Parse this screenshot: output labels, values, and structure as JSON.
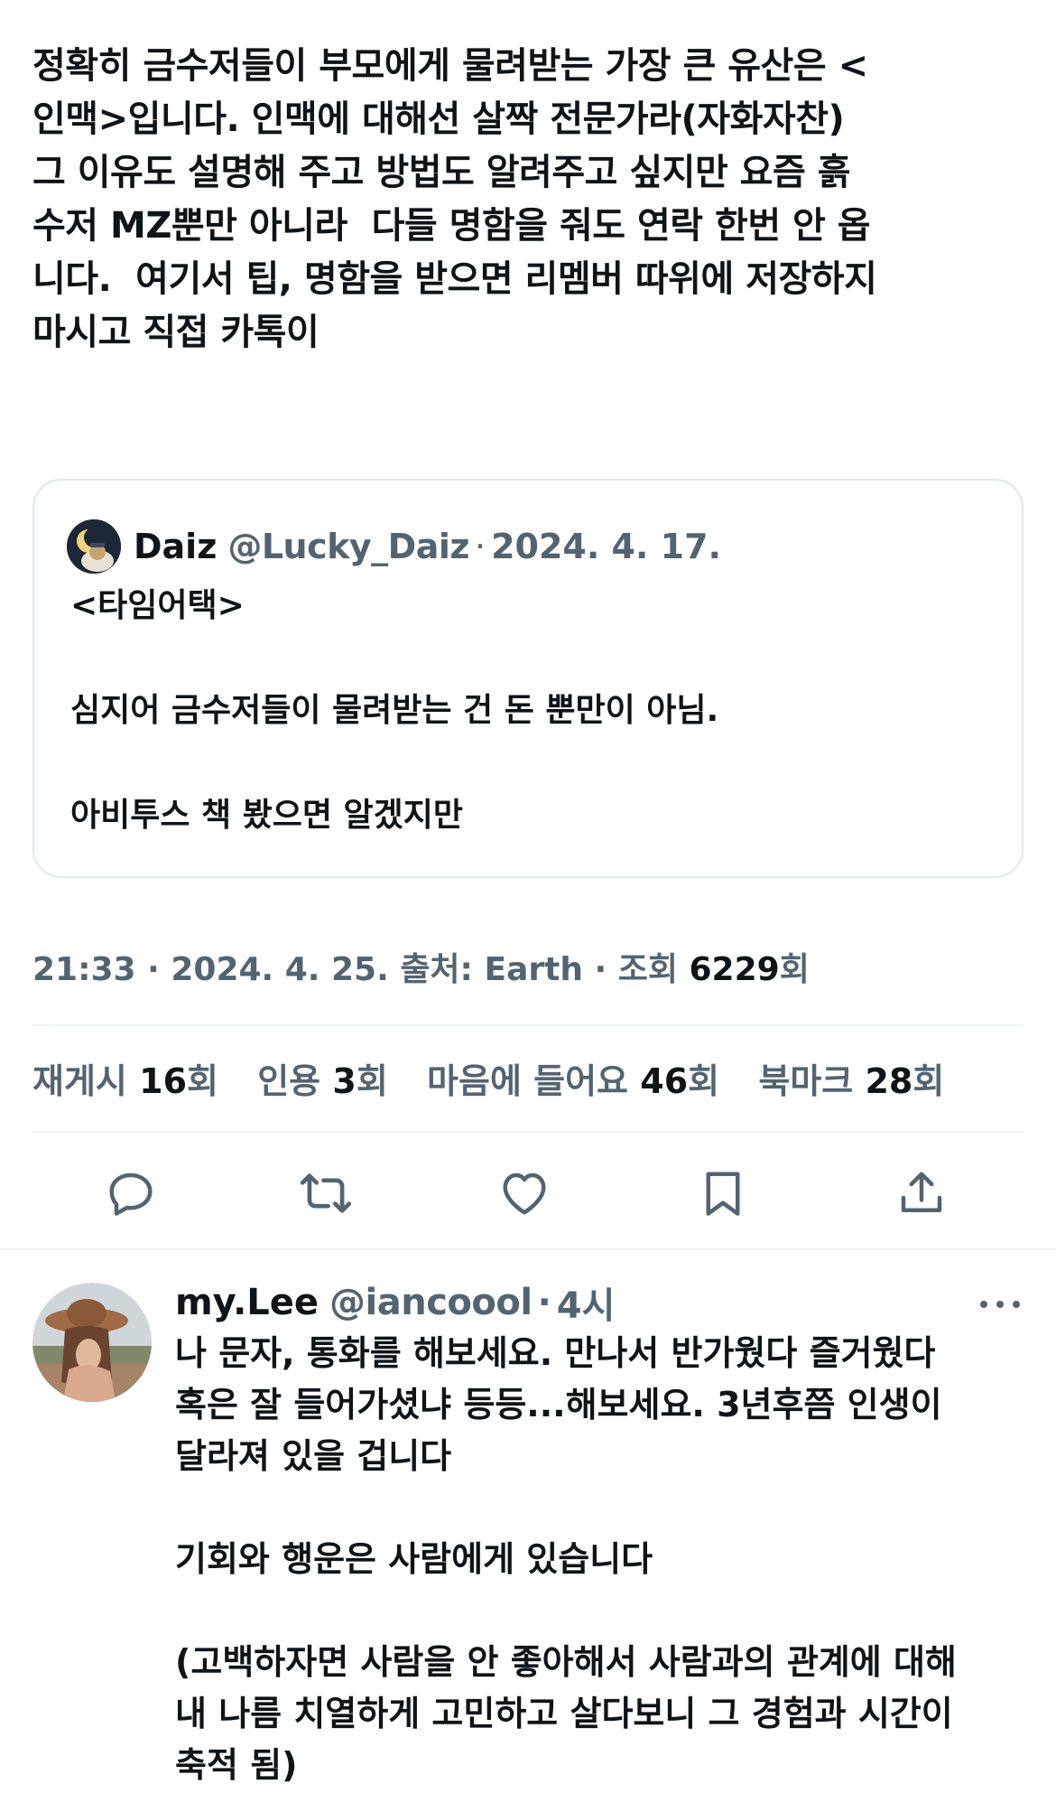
{
  "tweet": {
    "text": "정확히 금수저들이 부모에게 물려받는 가장 큰 유산은 <\n인맥>입니다. 인맥에 대해선 살짝 전문가라(자화자찬)\n그 이유도 설명해 주고 방법도 알려주고 싶지만 요즘 흙\n수저 MZ뿐만 아니라  다들 명함을 줘도 연락 한번 안 옵\n니다.  여기서 팁, 명함을 받으면 리멤버 따위에 저장하지\n마시고 직접 카톡이"
  },
  "quote": {
    "name": "Daiz",
    "handle": "@Lucky_Daiz",
    "separator": "·",
    "date": "2024. 4. 17.",
    "body": "<타임어택>\n\n심지어 금수저들이 물려받는 건 돈 뿐만이 아님.\n\n아비투스 책 봤으면 알겠지만"
  },
  "meta": {
    "time": "21:33",
    "sep1": " · ",
    "date": "2024. 4. 25.",
    "source_label": " 출처: ",
    "source": "Earth",
    "sep2": " · ",
    "views_label": "조회 ",
    "views": "6229",
    "views_suffix": "회"
  },
  "stats": {
    "reposts_label": "재게시 ",
    "reposts": "16",
    "reposts_suffix": "회",
    "quotes_label": "인용 ",
    "quotes": "3",
    "quotes_suffix": "회",
    "likes_label": "마음에 들어요 ",
    "likes": "46",
    "likes_suffix": "회",
    "bookmarks_label": "북마크 ",
    "bookmarks": "28",
    "bookmarks_suffix": "회"
  },
  "actions": {
    "icons": [
      "reply-icon",
      "repost-icon",
      "like-icon",
      "bookmark-icon",
      "share-icon"
    ]
  },
  "reply": {
    "name": "my.Lee",
    "handle": "@iancoool",
    "separator": "·",
    "time": "4시",
    "body": "나 문자, 통화를 해보세요. 만나서 반가웠다 즐거웠다\n혹은 잘 들어가셨냐 등등...해보세요. 3년후쯤 인생이\n달라져 있을 겁니다\n\n기회와 행운은 사람에게 있습니다\n\n(고백하자면 사람을 안 좋아해서 사람과의 관계에 대해\n내 나름 치열하게 고민하고 살다보니 그 경험과 시간이\n축적 됨)"
  },
  "colors": {
    "text": "#0f1419",
    "secondary": "#536471",
    "border": "#e1e8ed",
    "divider": "#eff3f4",
    "background": "#ffffff"
  }
}
